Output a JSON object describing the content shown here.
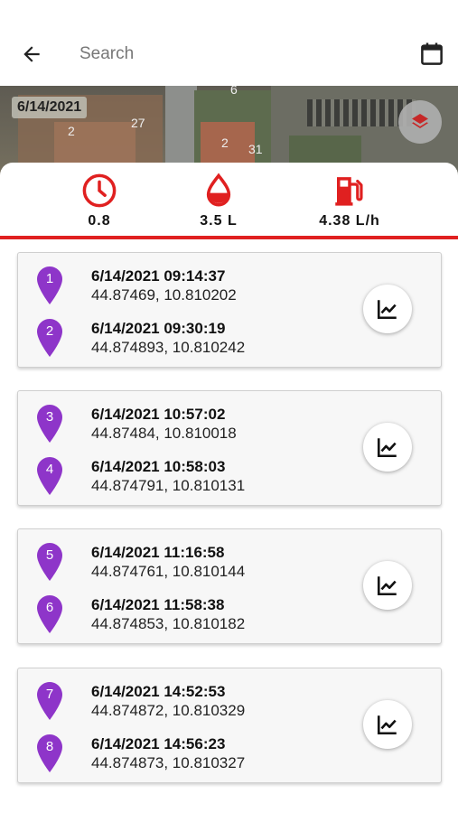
{
  "search": {
    "placeholder": "Search",
    "value": ""
  },
  "map": {
    "date_label": "6/14/2021",
    "labels": [
      "27",
      "2",
      "31",
      "2",
      "6"
    ]
  },
  "stats": [
    {
      "icon": "clock-icon",
      "value": "0.8"
    },
    {
      "icon": "drop-icon",
      "value": "3.5 L"
    },
    {
      "icon": "fuel-pump-icon",
      "value": "4.38 L/h"
    }
  ],
  "trips": [
    {
      "points": [
        {
          "num": "1",
          "time": "6/14/2021 09:14:37",
          "coords": "44.87469, 10.810202"
        },
        {
          "num": "2",
          "time": "6/14/2021 09:30:19",
          "coords": "44.874893, 10.810242"
        }
      ]
    },
    {
      "points": [
        {
          "num": "3",
          "time": "6/14/2021 10:57:02",
          "coords": "44.87484, 10.810018"
        },
        {
          "num": "4",
          "time": "6/14/2021 10:58:03",
          "coords": "44.874791, 10.810131"
        }
      ]
    },
    {
      "points": [
        {
          "num": "5",
          "time": "6/14/2021 11:16:58",
          "coords": "44.874761, 10.810144"
        },
        {
          "num": "6",
          "time": "6/14/2021 11:58:38",
          "coords": "44.874853, 10.810182"
        }
      ]
    },
    {
      "points": [
        {
          "num": "7",
          "time": "6/14/2021 14:52:53",
          "coords": "44.874872, 10.810329"
        },
        {
          "num": "8",
          "time": "6/14/2021 14:56:23",
          "coords": "44.874873, 10.810327"
        }
      ]
    }
  ],
  "colors": {
    "accent": "#e02020",
    "pin": "#8e35c9"
  }
}
